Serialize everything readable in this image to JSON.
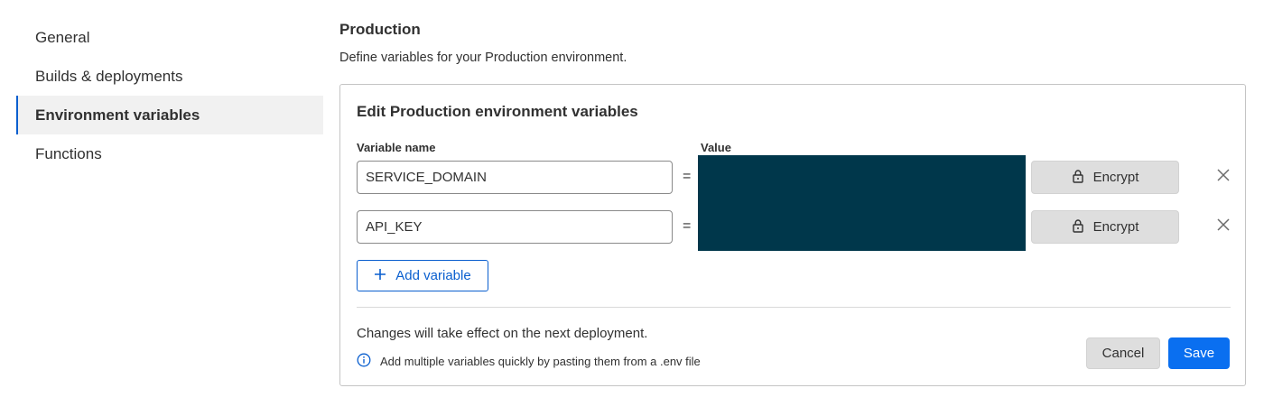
{
  "sidebar": {
    "items": [
      {
        "label": "General",
        "active": false
      },
      {
        "label": "Builds & deployments",
        "active": false
      },
      {
        "label": "Environment variables",
        "active": true
      },
      {
        "label": "Functions",
        "active": false
      }
    ]
  },
  "section": {
    "title": "Production",
    "description": "Define variables for your Production environment."
  },
  "card": {
    "title": "Edit Production environment variables",
    "name_column_label": "Variable name",
    "value_column_label": "Value",
    "variables": [
      {
        "name": "SERVICE_DOMAIN",
        "equals": "=",
        "encrypt_label": "Encrypt"
      },
      {
        "name": "API_KEY",
        "equals": "=",
        "encrypt_label": "Encrypt"
      }
    ],
    "add_variable_label": "Add variable",
    "footer_note": "Changes will take effect on the next deployment.",
    "hint": "Add multiple variables quickly by pasting them from a .env file",
    "cancel_label": "Cancel",
    "save_label": "Save"
  },
  "icons": {
    "lock": "lock-icon",
    "close": "close-icon",
    "plus": "plus-icon",
    "info": "info-icon"
  },
  "colors": {
    "accent": "#0a5fcf",
    "primary_button": "#0a6ff0",
    "redaction": "#00374b"
  }
}
